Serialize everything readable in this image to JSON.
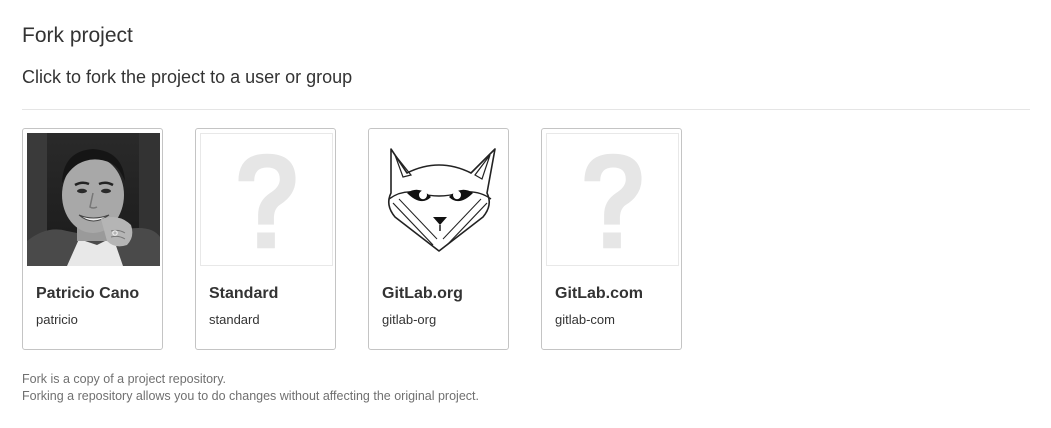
{
  "header": {
    "title": "Fork project",
    "subtitle": "Click to fork the project to a user or group"
  },
  "namespaces": [
    {
      "name": "Patricio Cano",
      "path": "patricio",
      "avatar": "user-photo"
    },
    {
      "name": "Standard",
      "path": "standard",
      "avatar": "question-mark-placeholder"
    },
    {
      "name": "GitLab.org",
      "path": "gitlab-org",
      "avatar": "gitlab-fox-logo"
    },
    {
      "name": "GitLab.com",
      "path": "gitlab-com",
      "avatar": "question-mark-placeholder"
    }
  ],
  "help": {
    "line1": "Fork is a copy of a project repository.",
    "line2": "Forking a repository allows you to do changes without affecting the original project."
  },
  "colors": {
    "card_border": "#c4c4c4",
    "placeholder_glyph": "#e6e6e6",
    "help_text": "#707070"
  }
}
